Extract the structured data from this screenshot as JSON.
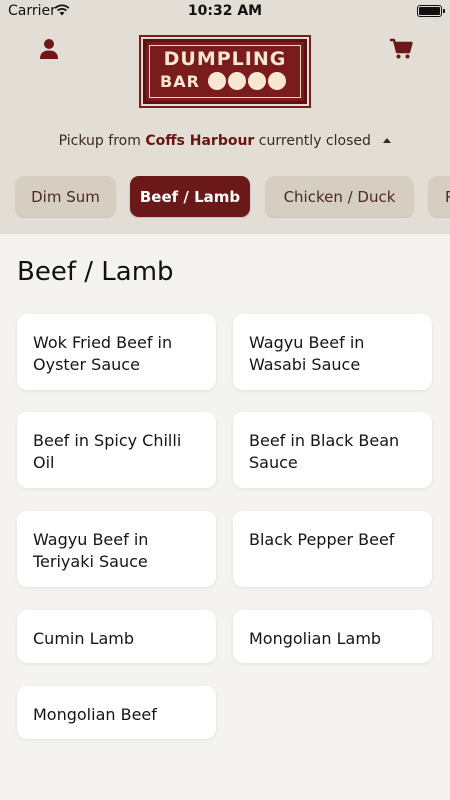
{
  "status_bar": {
    "carrier": "Carrier",
    "time": "10:32 AM"
  },
  "header": {
    "logo": {
      "line1": "DUMPLING",
      "line2": "BAR",
      "seal_text": "餃子小館"
    },
    "pickup": {
      "prefix": "Pickup from",
      "location": "Coffs Harbour",
      "suffix": "currently closed"
    },
    "icons": {
      "profile": "person-icon",
      "cart": "cart-icon"
    }
  },
  "tabs": [
    {
      "label": "Dim Sum",
      "active": false
    },
    {
      "label": "Beef / Lamb",
      "active": true
    },
    {
      "label": "Chicken / Duck",
      "active": false
    },
    {
      "label": "P",
      "active": false
    }
  ],
  "section": {
    "title": "Beef / Lamb",
    "items": [
      {
        "name": "Wok Fried Beef in Oyster Sauce"
      },
      {
        "name": "Wagyu Beef in Wasabi Sauce"
      },
      {
        "name": "Beef in Spicy Chilli Oil"
      },
      {
        "name": "Beef in Black Bean Sauce"
      },
      {
        "name": "Wagyu Beef in Teriyaki Sauce"
      },
      {
        "name": "Black Pepper Beef"
      },
      {
        "name": "Cumin Lamb"
      },
      {
        "name": "Mongolian Lamb"
      },
      {
        "name": "Mongolian Beef"
      }
    ]
  },
  "colors": {
    "brand": "#6a1818",
    "header_bg": "#e2ded5",
    "tab_bg": "#d6cfc1",
    "page_bg": "#f4f3f0"
  }
}
